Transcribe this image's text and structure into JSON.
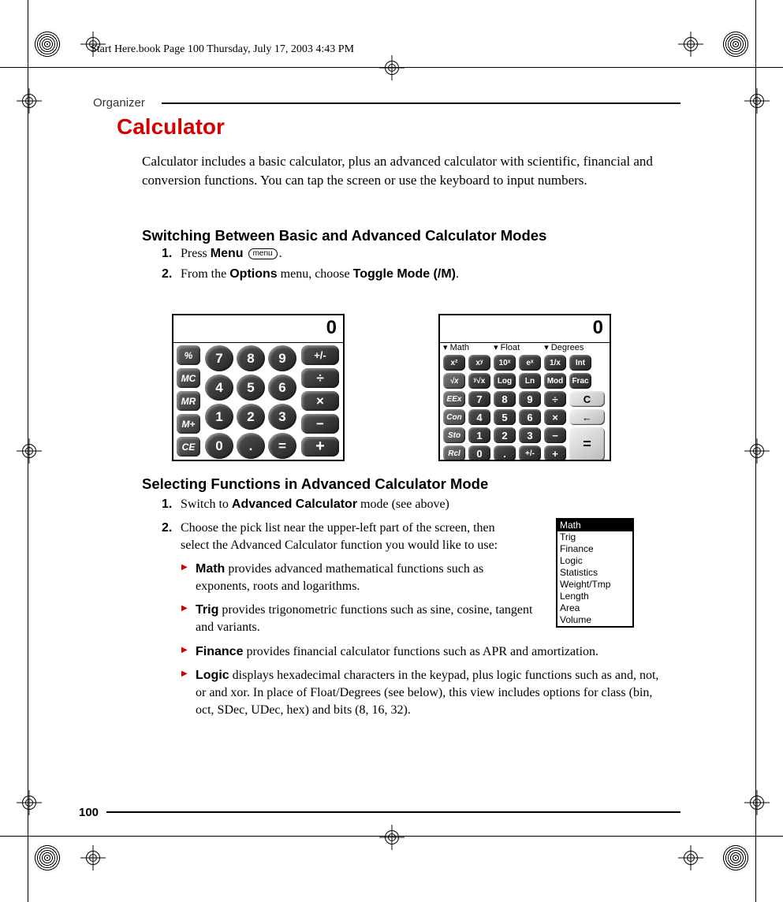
{
  "book_header": "Start Here.book  Page 100  Thursday, July 17, 2003  4:43 PM",
  "chapter_label": "Organizer",
  "title": "Calculator",
  "intro": "Calculator includes a basic calculator, plus an advanced calculator with scientific, financial and conversion functions. You can tap the screen or use the keyboard to input numbers.",
  "h2a": "Switching Between Basic and Advanced Calculator Modes",
  "steps1": {
    "s1_num": "1.",
    "s1_a": "Press ",
    "s1_bold": "Menu",
    "s1_pill": "menu",
    "s1_end": ".",
    "s2_num": "2.",
    "s2_a": "From the ",
    "s2_bold1": "Options",
    "s2_mid": " menu, choose ",
    "s2_bold2": "Toggle Mode (/M)",
    "s2_end": "."
  },
  "calc_display": "0",
  "basic_keys": {
    "side": [
      "%",
      "MC",
      "MR",
      "M+",
      "CE"
    ],
    "num": [
      "7",
      "8",
      "9",
      "4",
      "5",
      "6",
      "1",
      "2",
      "3",
      "0",
      ".",
      "="
    ],
    "op": [
      "+/-",
      "÷",
      "×",
      "−",
      "+"
    ]
  },
  "adv_bar": {
    "math": "▾ Math",
    "float": "▾ Float",
    "deg": "▾ Degrees"
  },
  "adv_keys": {
    "side": [
      "",
      "√x",
      "EEx",
      "Con",
      "Sto",
      "Rcl"
    ],
    "row0": [
      "x²",
      "xʸ",
      "10ˣ",
      "eˣ",
      "1/x",
      "Int"
    ],
    "row1": [
      "ʸ√x",
      "Log",
      "Ln",
      "Mod",
      "Frac"
    ],
    "num": [
      "7",
      "8",
      "9",
      "4",
      "5",
      "6",
      "1",
      "2",
      "3",
      "0",
      ".",
      "+/-"
    ],
    "opcol": [
      "÷",
      "×",
      "−",
      "+"
    ],
    "right": [
      "C",
      "←",
      "",
      "="
    ]
  },
  "h2b": "Selecting Functions in Advanced Calculator Mode",
  "steps2": {
    "s1_num": "1.",
    "s1_a": "Switch to ",
    "s1_bold": "Advanced Calculator",
    "s1_end": " mode (see above)",
    "s2_num": "2.",
    "s2_text": "Choose the pick list near the upper-left part of the screen, then select the Advanced Calculator function you would like to use:"
  },
  "bullets": {
    "math_label": "Math",
    "math_text": " provides advanced mathematical functions such as exponents, roots and logarithms.",
    "trig_label": "Trig",
    "trig_text": " provides trigonometric functions such as sine, cosine, tangent and variants.",
    "fin_label": "Finance",
    "fin_text": " provides financial calculator functions such as APR and amortization.",
    "logic_label": "Logic",
    "logic_text": " displays hexadecimal characters in the keypad, plus logic functions such as and, not, or and xor. In place of Float/Degrees (see below), this view includes options for class (bin, oct, SDec, UDec, hex) and bits (8, 16, 32)."
  },
  "picklist": [
    "Math",
    "Trig",
    "Finance",
    "Logic",
    "Statistics",
    "Weight/Tmp",
    "Length",
    "Area",
    "Volume"
  ],
  "page_number": "100"
}
